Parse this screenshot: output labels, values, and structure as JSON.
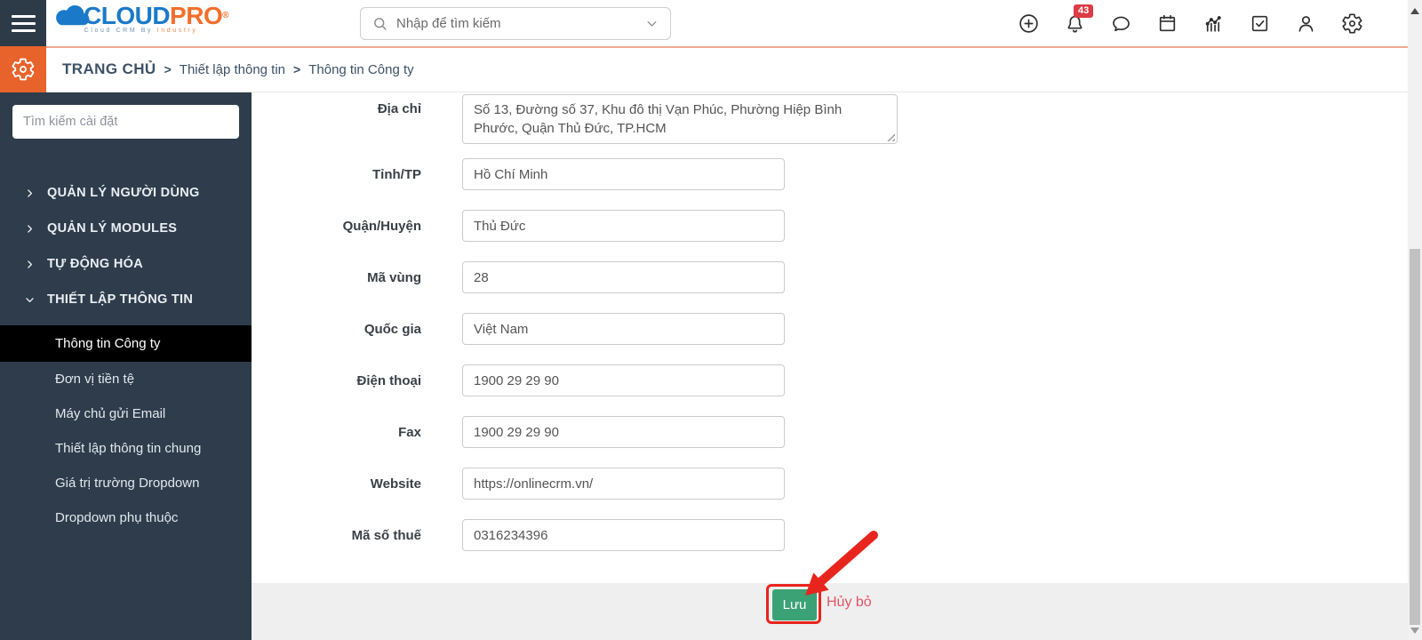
{
  "header": {
    "logo": {
      "part1": "CLOUD",
      "part2": "PRO",
      "registered": "®",
      "tagline1": "Cloud CRM By",
      "tagline2": "Industry"
    },
    "search": {
      "placeholder": "Nhập để tìm kiếm"
    },
    "notification_count": "43",
    "icons": [
      "plus-circle-icon",
      "bell-icon",
      "chat-icon",
      "calendar-icon",
      "analytics-icon",
      "task-check-icon",
      "user-icon",
      "gear-icon"
    ]
  },
  "breadcrumb": {
    "root": "TRANG CHỦ",
    "separator": ">",
    "items": [
      "Thiết lập thông tin",
      "Thông tin Công ty"
    ]
  },
  "sidebar": {
    "search_placeholder": "Tìm kiếm cài đặt",
    "sections": [
      {
        "label": "QUẢN LÝ NGƯỜI DÙNG",
        "expanded": false
      },
      {
        "label": "QUẢN LÝ MODULES",
        "expanded": false
      },
      {
        "label": "TỰ ĐỘNG HÓA",
        "expanded": false
      },
      {
        "label": "THIẾT LẬP THÔNG TIN",
        "expanded": true
      }
    ],
    "submenu": [
      {
        "label": "Thông tin Công ty",
        "active": true
      },
      {
        "label": "Đơn vị tiền tệ",
        "active": false
      },
      {
        "label": "Máy chủ gửi Email",
        "active": false
      },
      {
        "label": "Thiết lập thông tin chung",
        "active": false
      },
      {
        "label": "Giá trị trường Dropdown",
        "active": false
      },
      {
        "label": "Dropdown phụ thuộc",
        "active": false
      }
    ]
  },
  "form": {
    "fields": [
      {
        "label": "Địa chỉ",
        "value": "Số 13, Đường số 37, Khu đô thị Vạn Phúc, Phường Hiệp Bình Phước, Quận Thủ Đức, TP.HCM",
        "type": "textarea"
      },
      {
        "label": "Tỉnh/TP",
        "value": "Hồ Chí Minh",
        "type": "text"
      },
      {
        "label": "Quận/Huyện",
        "value": "Thủ Đức",
        "type": "text"
      },
      {
        "label": "Mã vùng",
        "value": "28",
        "type": "text"
      },
      {
        "label": "Quốc gia",
        "value": "Việt Nam",
        "type": "text"
      },
      {
        "label": "Điện thoại",
        "value": "1900 29 29 90",
        "type": "text"
      },
      {
        "label": "Fax",
        "value": "1900 29 29 90",
        "type": "text"
      },
      {
        "label": "Website",
        "value": "https://onlinecrm.vn/",
        "type": "text"
      },
      {
        "label": "Mã số thuế",
        "value": "0316234396",
        "type": "text"
      }
    ],
    "buttons": {
      "save": "Lưu",
      "cancel": "Hủy bỏ"
    }
  },
  "colors": {
    "brand_blue": "#1a7ac9",
    "brand_orange": "#f26f2d",
    "topbar_accent": "#f2a893",
    "sidebar_bg": "#2e3c4b",
    "active_item_bg": "#000000",
    "save_green": "#3ba275",
    "cancel_red": "#e25465",
    "badge_red": "#dd3b46",
    "annotation_red": "#e8251d"
  }
}
